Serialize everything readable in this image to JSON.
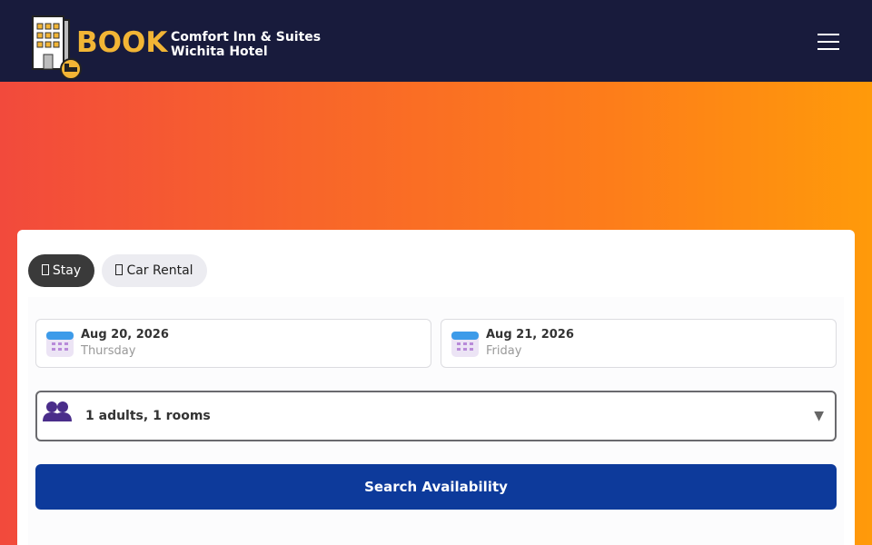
{
  "header": {
    "brand": "BOOK",
    "hotel_line1": "Comfort Inn & Suites",
    "hotel_line2": "Wichita Hotel",
    "logo_icon": "hotel-building-icon",
    "menu_icon": "hamburger-menu-icon"
  },
  "tabs": [
    {
      "label": "Stay",
      "icon": "bed-icon",
      "active": true
    },
    {
      "label": "Car Rental",
      "icon": "car-icon",
      "active": false
    }
  ],
  "checkin": {
    "date": "Aug 20, 2026",
    "weekday": "Thursday",
    "icon": "calendar-icon"
  },
  "checkout": {
    "date": "Aug 21, 2026",
    "weekday": "Friday",
    "icon": "calendar-icon"
  },
  "guests": {
    "value": "1 adults, 1 rooms",
    "icon": "people-icon",
    "chevron": "▼"
  },
  "search": {
    "label": "Search Availability"
  },
  "colors": {
    "header_bg": "#181b3c",
    "brand": "#f2b535",
    "button": "#0d3a9b",
    "gradient_start": "#f24a3c",
    "gradient_end": "#ff9a0a"
  }
}
